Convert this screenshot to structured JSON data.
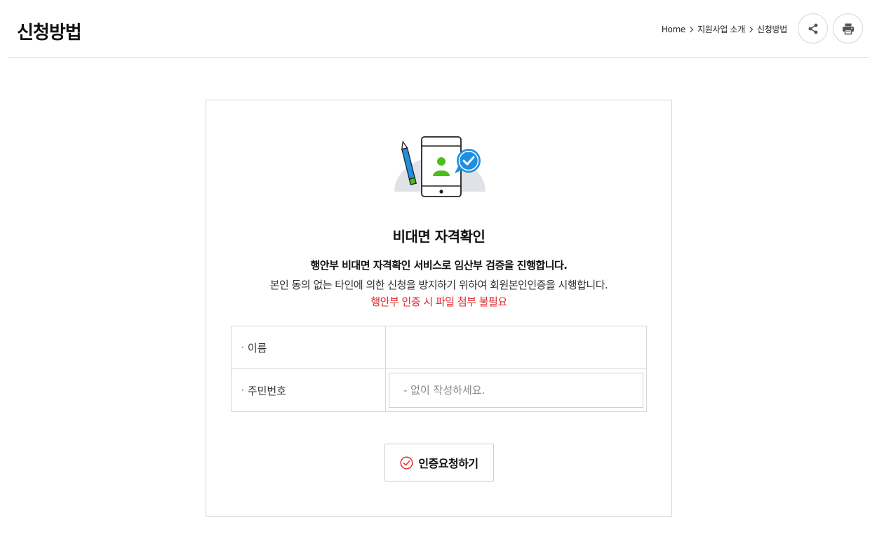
{
  "header": {
    "title": "신청방법",
    "breadcrumb": [
      "Home",
      "지원사업 소개",
      "신청방법"
    ]
  },
  "card": {
    "title": "비대면 자격확인",
    "desc_bold": "행안부 비대면 자격확인 서비스로 임산부 검증을 진행합니다.",
    "desc": "본인 동의 없는 타인에 의한 신청을 방지하기 위하여 회원본인인증을 시행합니다.",
    "desc_red": "행안부 인증 시 파일 첨부 불필요",
    "form": {
      "name_label": "이름",
      "name_value": "",
      "ssn_label": "주민번호",
      "ssn_placeholder": "- 없이 작성하세요."
    },
    "submit_label": "인증요청하기"
  },
  "colors": {
    "accent_red": "#e2262c",
    "illustration_green": "#4cbe1a",
    "illustration_blue": "#1f8fe0"
  },
  "icons": [
    "share-icon",
    "print-icon",
    "phone-verify-illustration",
    "check-circle-icon"
  ]
}
